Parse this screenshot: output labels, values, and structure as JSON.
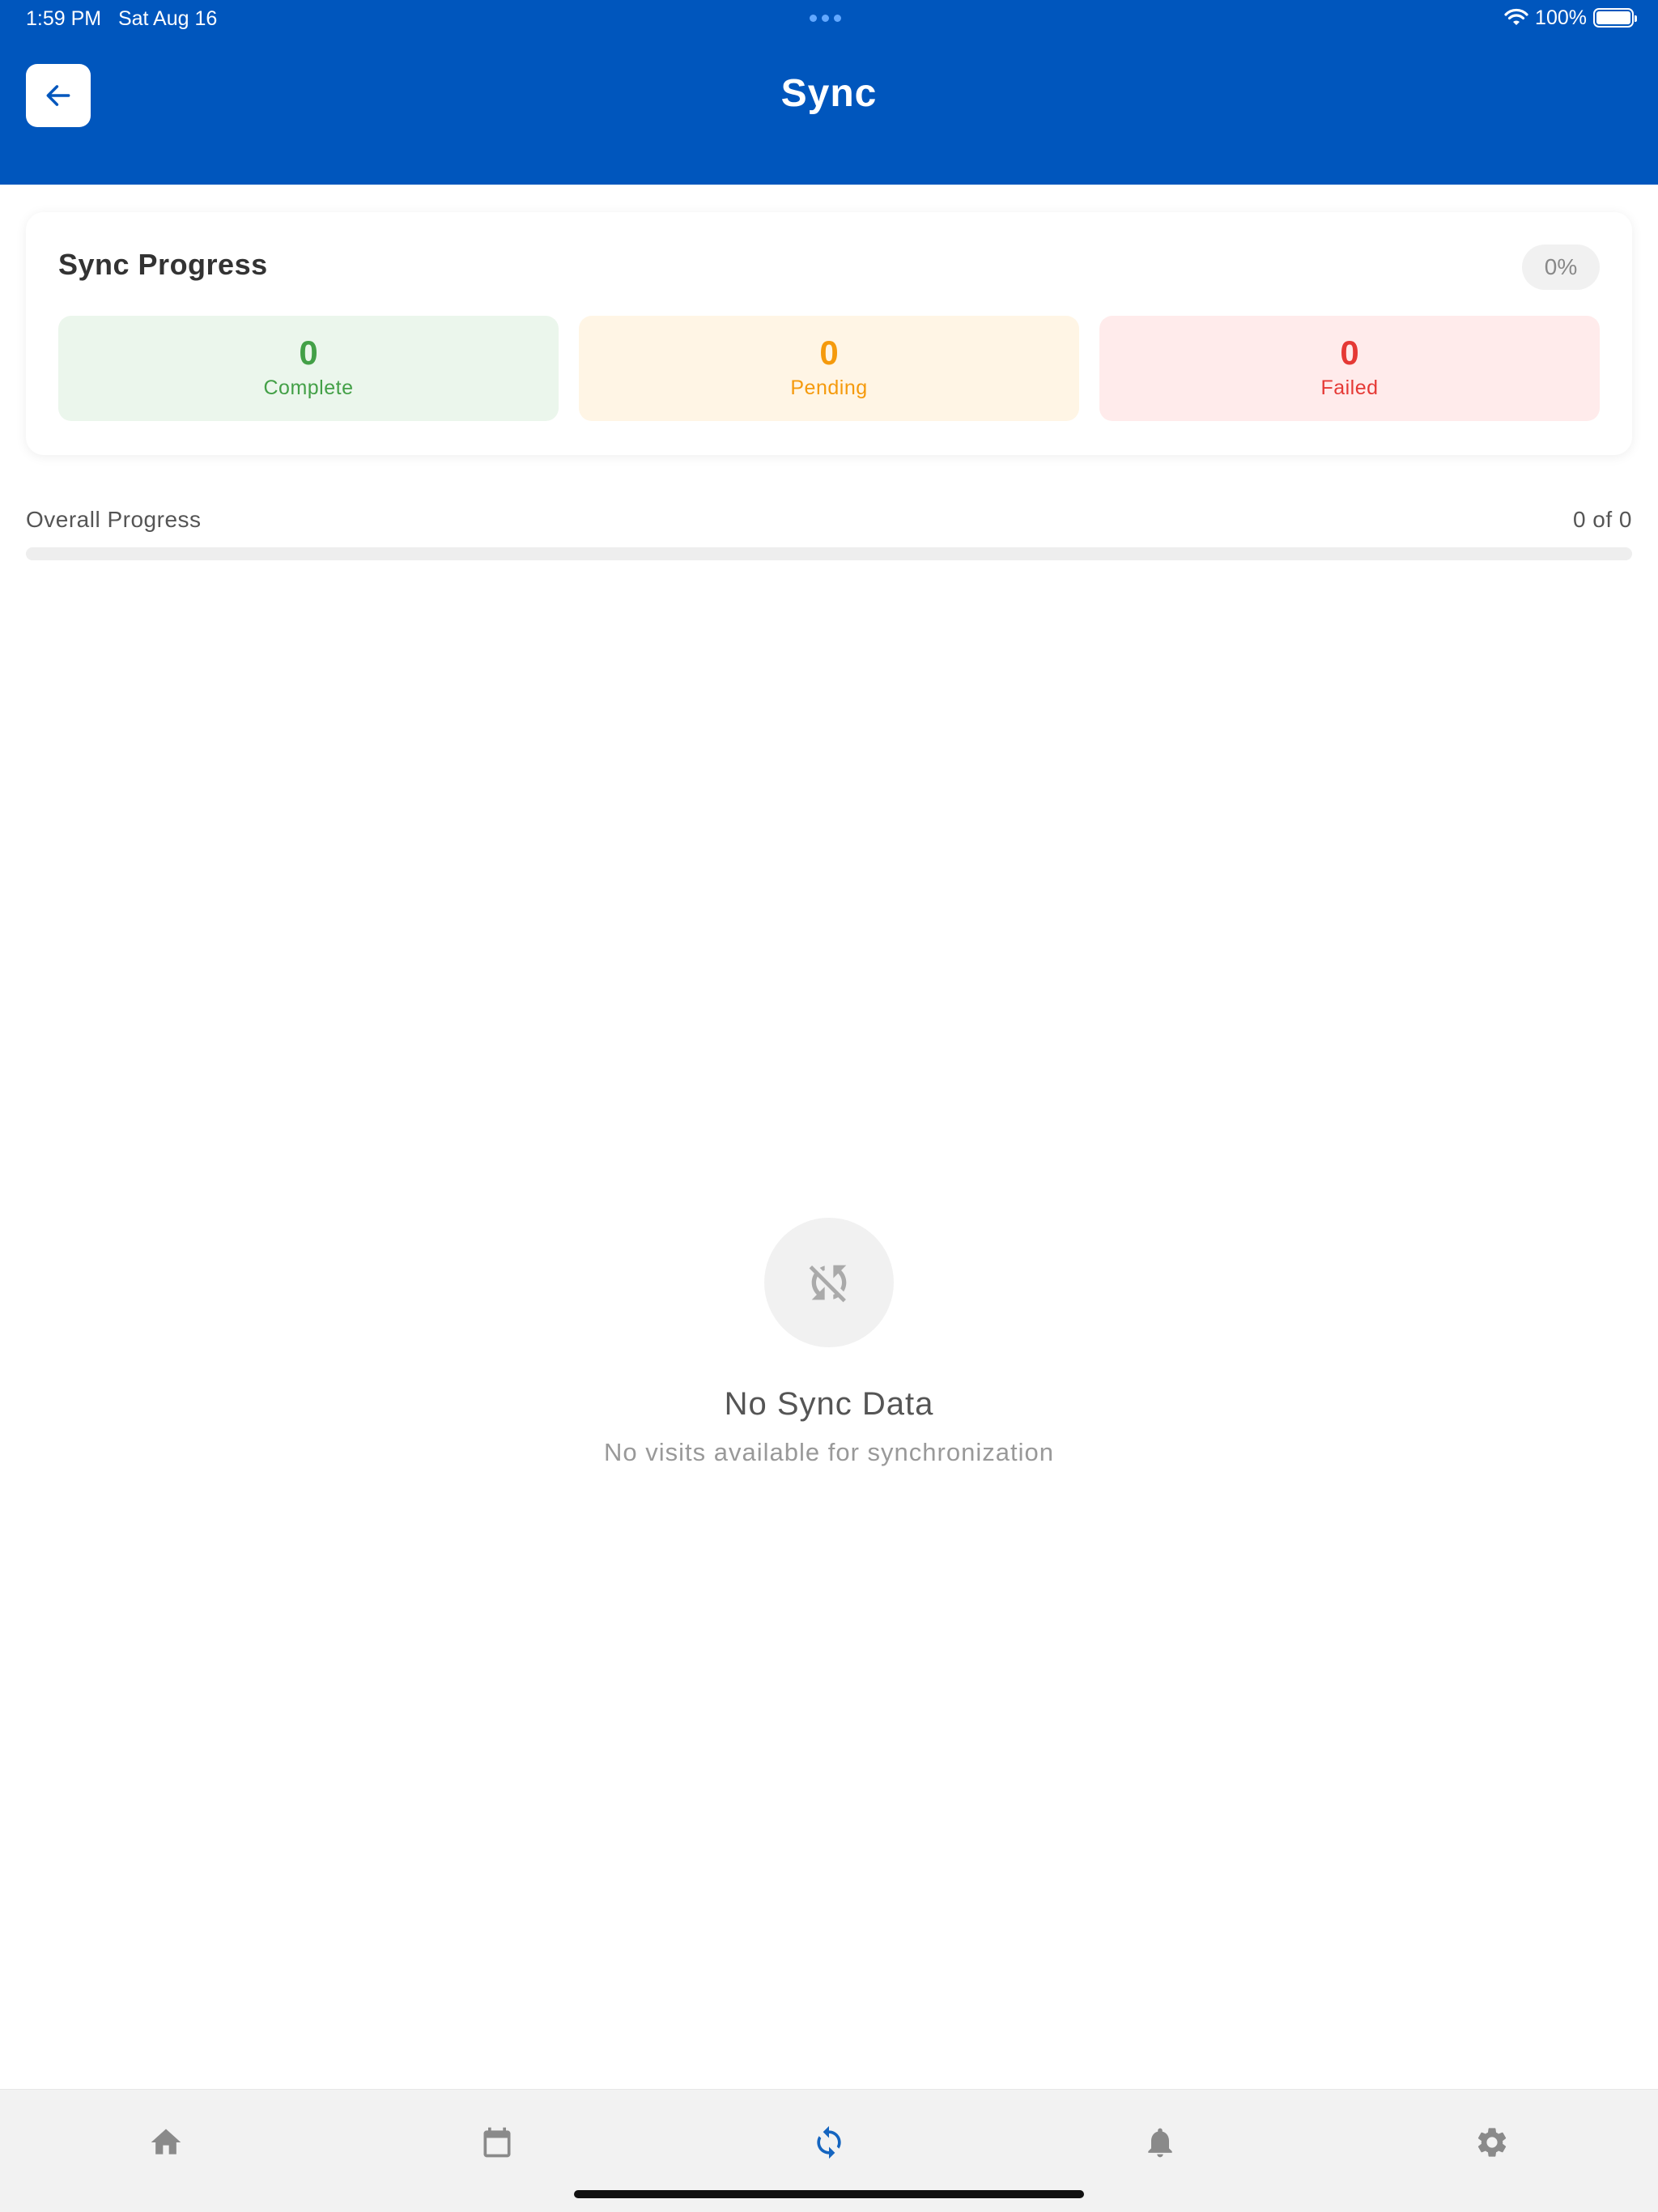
{
  "status_bar": {
    "time": "1:59 PM",
    "date": "Sat Aug 16",
    "battery": "100%",
    "icons": [
      "wifi-icon",
      "battery-icon"
    ]
  },
  "header": {
    "title": "Sync",
    "back_icon": "arrow-left-icon",
    "background": "#0056bd"
  },
  "sync_card": {
    "title": "Sync Progress",
    "percent": "0%",
    "stats": [
      {
        "value": "0",
        "label": "Complete",
        "color": "#43a047",
        "bg": "#ebf6ec"
      },
      {
        "value": "0",
        "label": "Pending",
        "color": "#f59a0c",
        "bg": "#fff5e5"
      },
      {
        "value": "0",
        "label": "Failed",
        "color": "#e53935",
        "bg": "#ffebeb"
      }
    ]
  },
  "overall": {
    "label": "Overall Progress",
    "count": "0 of 0",
    "progress_fraction": 0
  },
  "empty_state": {
    "icon": "sync-disabled-icon",
    "title": "No Sync Data",
    "subtitle": "No visits available for synchronization"
  },
  "tabbar": {
    "active_color": "#1565c0",
    "inactive_color": "#8a8a8a",
    "tabs": [
      {
        "icon": "home-icon",
        "active": false
      },
      {
        "icon": "calendar-icon",
        "active": false
      },
      {
        "icon": "sync-icon",
        "active": true
      },
      {
        "icon": "bell-icon",
        "active": false
      },
      {
        "icon": "gear-icon",
        "active": false
      }
    ]
  }
}
